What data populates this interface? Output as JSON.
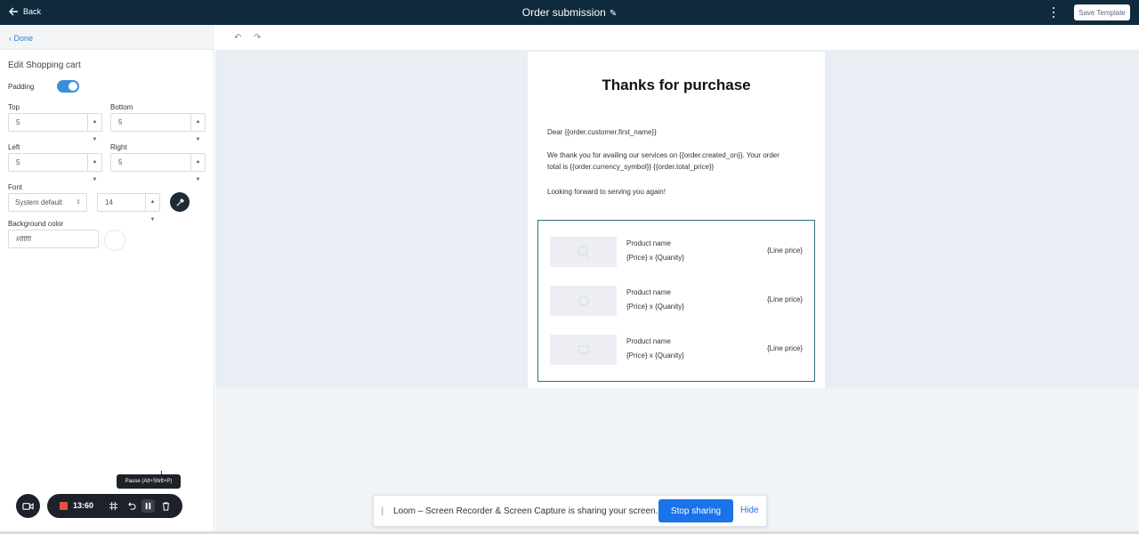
{
  "topbar": {
    "back_label": "Back",
    "title": "Order submission",
    "save_label": "Save Template"
  },
  "sidebar": {
    "done_label": "Done",
    "panel_title": "Edit Shopping cart",
    "padding_label": "Padding",
    "padding_enabled": true,
    "top_label": "Top",
    "top_value": "5",
    "bottom_label": "Bottom",
    "bottom_value": "5",
    "left_label": "Left",
    "left_value": "5",
    "right_label": "Right",
    "right_value": "5",
    "font_label": "Font",
    "font_family_value": "System default",
    "font_size_value": "14",
    "bg_label": "Background color",
    "bg_value": "#ffffff"
  },
  "email": {
    "title": "Thanks for purchase",
    "greeting": "Dear {{order.customer.first_name}}",
    "body_line1": "We thank you for availing our services on {{order.created_on}}. Your order",
    "body_line2": "total is {{order.currency_symbol}} {{order.total_price}}",
    "closing": "Looking forward to serving you again!",
    "cart_items": [
      {
        "name": "Product name",
        "qty": "{Price} x {Quanity}",
        "line_price": "{Line price}"
      },
      {
        "name": "Product name",
        "qty": "{Price} x {Quanity}",
        "line_price": "{Line price}"
      },
      {
        "name": "Product name",
        "qty": "{Price} x {Quanity}",
        "line_price": "{Line price}"
      }
    ]
  },
  "loom": {
    "time": "13:60",
    "tooltip": "Pause (Alt+Shift+P)",
    "share_message": "Loom – Screen Recorder & Screen Capture is sharing your screen.",
    "stop_label": "Stop sharing",
    "hide_label": "Hide"
  },
  "colors": {
    "topbar": "#0f2a3d",
    "accent": "#3a8fd9",
    "stop_button": "#1a73e8",
    "cart_border": "#2f6e79"
  }
}
